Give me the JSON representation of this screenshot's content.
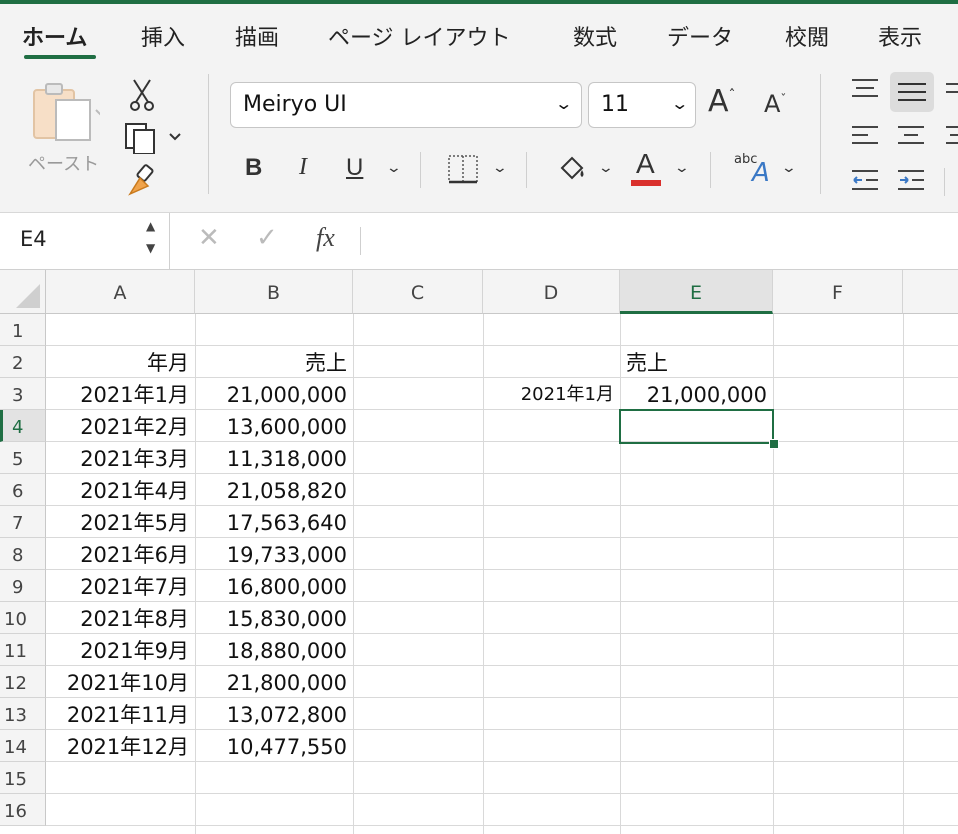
{
  "ribbon_tabs": [
    "ホーム",
    "挿入",
    "描画",
    "ページ レイアウト",
    "数式",
    "データ",
    "校閲",
    "表示"
  ],
  "active_tab": "ホーム",
  "clipboard": {
    "paste_label": "ペースト"
  },
  "font": {
    "name": "Meiryo UI",
    "size": "11"
  },
  "formula_bar": {
    "name_box": "E4",
    "fx_label": "fx",
    "content": ""
  },
  "columns": [
    "A",
    "B",
    "C",
    "D",
    "E",
    "F"
  ],
  "selected_column": "E",
  "rows": [
    "1",
    "2",
    "3",
    "4",
    "5",
    "6",
    "7",
    "8",
    "9",
    "10",
    "11",
    "12",
    "13",
    "14",
    "15",
    "16"
  ],
  "selected_row": "4",
  "table": {
    "header": {
      "month": "年月",
      "sales": "売上"
    },
    "data": [
      {
        "month": "2021年1月",
        "sales": "21,000,000"
      },
      {
        "month": "2021年2月",
        "sales": "13,600,000"
      },
      {
        "month": "2021年3月",
        "sales": "11,318,000"
      },
      {
        "month": "2021年4月",
        "sales": "21,058,820"
      },
      {
        "month": "2021年5月",
        "sales": "17,563,640"
      },
      {
        "month": "2021年6月",
        "sales": "19,733,000"
      },
      {
        "month": "2021年7月",
        "sales": "16,800,000"
      },
      {
        "month": "2021年8月",
        "sales": "15,830,000"
      },
      {
        "month": "2021年9月",
        "sales": "18,880,000"
      },
      {
        "month": "2021年10月",
        "sales": "21,800,000"
      },
      {
        "month": "2021年11月",
        "sales": "13,072,800"
      },
      {
        "month": "2021年12月",
        "sales": "10,477,550"
      }
    ]
  },
  "lookup": {
    "header": "売上",
    "key": "2021年1月",
    "value": "21,000,000"
  },
  "colors": {
    "accent": "#1f6e43",
    "font_color_bar": "#d9302c"
  }
}
